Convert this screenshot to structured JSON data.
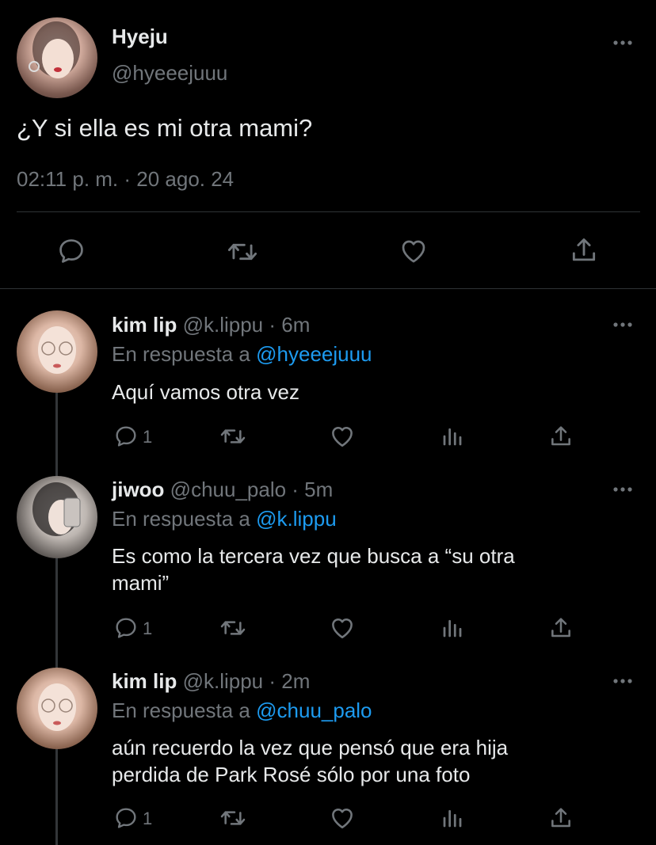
{
  "main_tweet": {
    "display_name": "Hyeju",
    "handle": "@hyeeejuuu",
    "text": "¿Y si ella es mi otra mami?",
    "timestamp": "02:11 p. m. · 20 ago. 24"
  },
  "replies": [
    {
      "display_name": "kim lip",
      "handle_time": "@k.lippu · 6m",
      "reply_prefix": "En respuesta a",
      "reply_to": "@hyeeejuuu",
      "text_lines": [
        "Aquí vamos otra vez"
      ],
      "reply_count": "1"
    },
    {
      "display_name": "jiwoo",
      "handle_time": "@chuu_palo · 5m",
      "reply_prefix": "En respuesta a",
      "reply_to": "@k.lippu",
      "text_lines": [
        "Es como la tercera vez que busca a “su otra",
        "mami”"
      ],
      "reply_count": "1"
    },
    {
      "display_name": "kim lip",
      "handle_time": "@k.lippu · 2m",
      "reply_prefix": "En respuesta a",
      "reply_to": "@chuu_palo",
      "text_lines": [
        "aún recuerdo la vez que pensó que era hija",
        "perdida de Park Rosé sólo por una foto"
      ],
      "reply_count": "1"
    }
  ],
  "colors": {
    "background": "#000000",
    "text": "#e7e9ea",
    "secondary": "#71767b",
    "link": "#1d9bf0",
    "divider": "#2f3336"
  },
  "icons": [
    "more-icon",
    "reply-icon",
    "retweet-icon",
    "like-icon",
    "share-icon",
    "views-icon"
  ]
}
